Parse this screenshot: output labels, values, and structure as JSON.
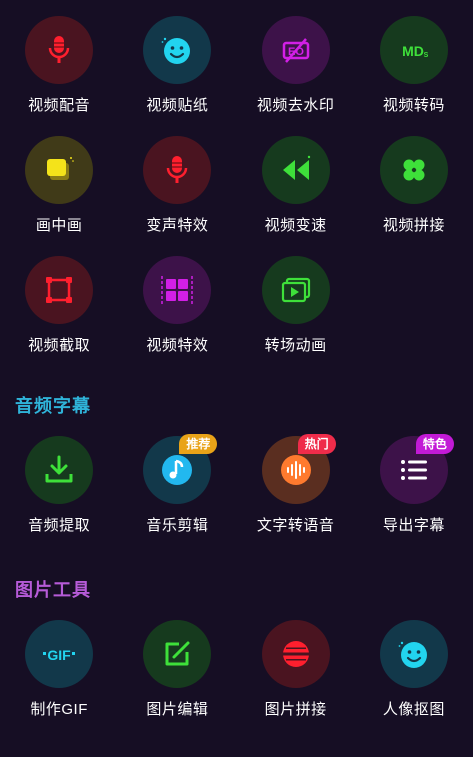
{
  "video_tools": [
    {
      "label": "视频配音",
      "icon": "microphone-icon",
      "bg": "#4a1420",
      "fg": "#ff1f2e"
    },
    {
      "label": "视频贴纸",
      "icon": "smiley-icon",
      "bg": "#12384a",
      "fg": "#22d4ef"
    },
    {
      "label": "视频去水印",
      "icon": "watermark-remove-icon",
      "bg": "#3d1249",
      "fg": "#d21fe6"
    },
    {
      "label": "视频转码",
      "icon": "mds-transcode-icon",
      "bg": "#163a1e",
      "fg": "#3ee03a"
    },
    {
      "label": "画中画",
      "icon": "picture-in-picture-icon",
      "bg": "#403a18",
      "fg": "#f4e31a"
    },
    {
      "label": "变声特效",
      "icon": "microphone-icon",
      "bg": "#4a1420",
      "fg": "#ff1f2e"
    },
    {
      "label": "视频变速",
      "icon": "rewind-icon",
      "bg": "#163a1e",
      "fg": "#3ee03a"
    },
    {
      "label": "视频拼接",
      "icon": "clover-icon",
      "bg": "#163a1e",
      "fg": "#3ee03a"
    },
    {
      "label": "视频截取",
      "icon": "crop-frame-icon",
      "bg": "#4a1420",
      "fg": "#ff1f2e"
    },
    {
      "label": "视频特效",
      "icon": "film-effects-icon",
      "bg": "#3d1249",
      "fg": "#d21fe6"
    },
    {
      "label": "转场动画",
      "icon": "transition-play-icon",
      "bg": "#163a1e",
      "fg": "#3ee03a"
    }
  ],
  "audio_section": {
    "title": "音频字幕",
    "color": "#2fb3d9"
  },
  "audio_tools": [
    {
      "label": "音频提取",
      "icon": "download-tray-icon",
      "bg": "#163a1e",
      "fg": "#3ee03a",
      "badge": null
    },
    {
      "label": "音乐剪辑",
      "icon": "music-note-icon",
      "bg": "#12384a",
      "fg": "#22b8ef",
      "badge": {
        "text": "推荐",
        "color": "#e9a318"
      }
    },
    {
      "label": "文字转语音",
      "icon": "sound-wave-icon",
      "bg": "#5a2e20",
      "fg": "#ff7a2e",
      "badge": {
        "text": "热门",
        "color": "#ef2c4a"
      }
    },
    {
      "label": "导出字幕",
      "icon": "subtitle-list-icon",
      "bg": "#3d1249",
      "fg": "#d21fe6",
      "badge": {
        "text": "特色",
        "color": "#c21ad6"
      }
    }
  ],
  "image_section": {
    "title": "图片工具",
    "color": "#b65bd8"
  },
  "image_tools": [
    {
      "label": "制作GIF",
      "icon": "gif-icon",
      "bg": "#12384a",
      "fg": "#22d4ef"
    },
    {
      "label": "图片编辑",
      "icon": "edit-image-icon",
      "bg": "#163a1e",
      "fg": "#3ee03a"
    },
    {
      "label": "图片拼接",
      "icon": "image-stitch-icon",
      "bg": "#4a1420",
      "fg": "#ff1f2e"
    },
    {
      "label": "人像抠图",
      "icon": "portrait-cutout-icon",
      "bg": "#12384a",
      "fg": "#22d4ef"
    }
  ]
}
